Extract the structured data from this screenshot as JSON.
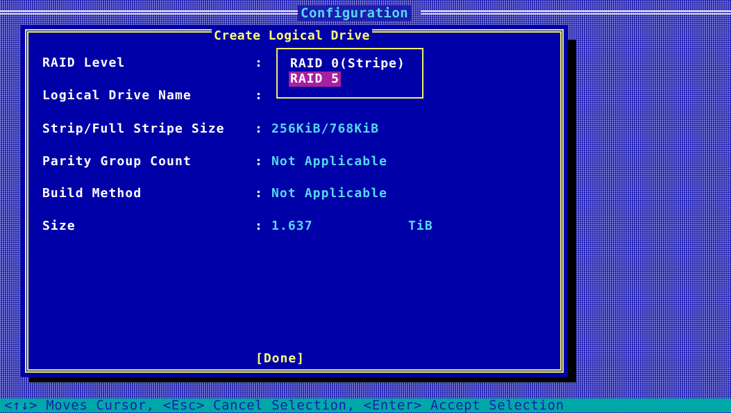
{
  "window": {
    "title": "Configuration"
  },
  "dialog": {
    "title": "Create Logical Drive",
    "fields": [
      {
        "label": "RAID Level",
        "colon": ":",
        "value": ""
      },
      {
        "label": "Logical Drive Name",
        "colon": ":",
        "value": ""
      },
      {
        "label": "Strip/Full Stripe Size",
        "colon": ":",
        "value": "256KiB/768KiB"
      },
      {
        "label": "Parity Group Count",
        "colon": ":",
        "value": "Not Applicable"
      },
      {
        "label": "Build Method",
        "colon": ":",
        "value": "Not Applicable"
      },
      {
        "label": "Size",
        "colon": ":",
        "value": "1.637",
        "unit": "TiB"
      }
    ],
    "raid_options": [
      {
        "label": "RAID 0(Stripe)",
        "selected": false
      },
      {
        "label": "RAID 5",
        "selected": true
      }
    ],
    "done_label": "[Done]"
  },
  "statusbar": {
    "text": "<↑↓> Moves Cursor, <Esc> Cancel Selection, <Enter> Accept Selection"
  },
  "colors": {
    "background": "#1c1cae",
    "dialog_bg": "#0000a8",
    "border": "#f0f070",
    "value_text": "#55d8f0",
    "highlight": "#a8209f",
    "statusbar_bg": "#00a8a8"
  }
}
